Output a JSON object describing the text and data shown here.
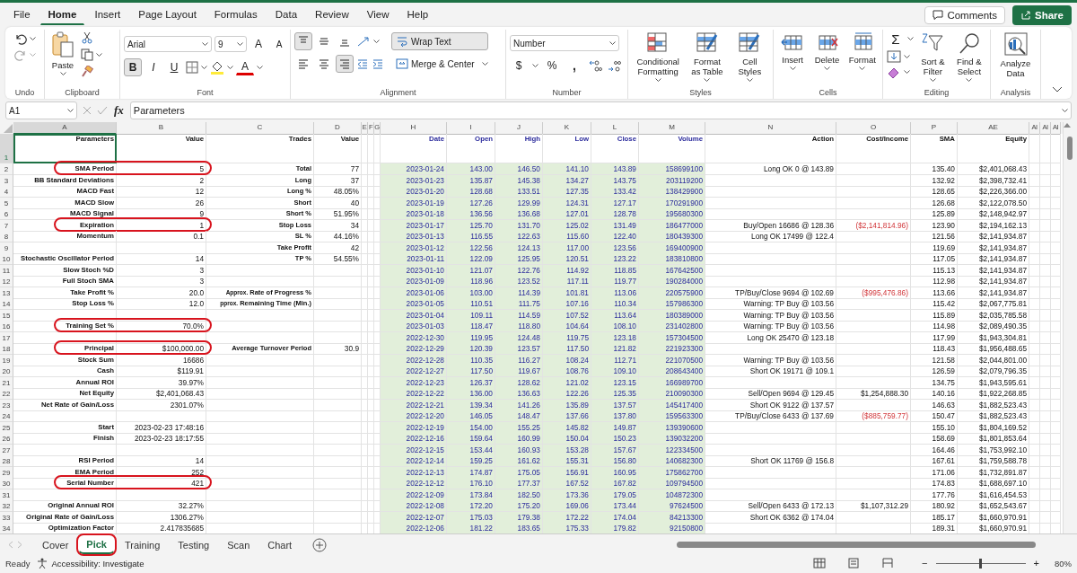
{
  "menu": {
    "tabs": [
      {
        "label": "File",
        "selected": false
      },
      {
        "label": "Home",
        "selected": true
      },
      {
        "label": "Insert",
        "selected": false
      },
      {
        "label": "Page Layout",
        "selected": false
      },
      {
        "label": "Formulas",
        "selected": false
      },
      {
        "label": "Data",
        "selected": false
      },
      {
        "label": "Review",
        "selected": false
      },
      {
        "label": "View",
        "selected": false
      },
      {
        "label": "Help",
        "selected": false
      }
    ],
    "comments": "Comments",
    "share": "Share"
  },
  "ribbon": {
    "undo": {
      "label": "Undo"
    },
    "clipboard": {
      "label": "Clipboard",
      "paste": "Paste"
    },
    "font": {
      "label": "Font",
      "name": "Arial",
      "size": "9",
      "grow": "A",
      "shrink": "A",
      "styles": [
        {
          "label": "B",
          "selected": true
        },
        {
          "label": "I",
          "selected": false
        },
        {
          "label": "U",
          "selected": false
        }
      ],
      "color_letter": "A"
    },
    "alignment": {
      "label": "Alignment",
      "vertical": [
        {
          "kind": "top",
          "selected": true
        },
        {
          "kind": "middle",
          "selected": false
        },
        {
          "kind": "bottom",
          "selected": false
        }
      ],
      "horizontal": [
        {
          "kind": "left",
          "selected": false
        },
        {
          "kind": "center",
          "selected": false
        },
        {
          "kind": "right",
          "selected": true
        }
      ],
      "wrap": {
        "label": "Wrap Text",
        "selected": true
      },
      "merge": "Merge & Center"
    },
    "number": {
      "label": "Number",
      "format": "Number",
      "currency": "$",
      "percent": "%",
      "comma": ","
    },
    "styles": {
      "label": "Styles",
      "buttons": [
        "Conditional Formatting",
        "Format as Table",
        "Cell Styles"
      ]
    },
    "cells": {
      "label": "Cells",
      "buttons": [
        "Insert",
        "Delete",
        "Format"
      ]
    },
    "editing": {
      "label": "Editing",
      "sum": "Σ",
      "sort": "Sort & Filter",
      "find": "Find & Select"
    },
    "analysis": {
      "label": "Analysis",
      "analyze": "Analyze Data"
    }
  },
  "formula_bar": {
    "name_box": "A1",
    "fx": "fx",
    "formula": "Parameters"
  },
  "grid": {
    "columns": [
      {
        "letter": "A",
        "heading": "Parameters",
        "selected": true
      },
      {
        "letter": "B",
        "heading": "Value",
        "selected": false
      },
      {
        "letter": "C",
        "heading": "Trades",
        "selected": false
      },
      {
        "letter": "D",
        "heading": "Value",
        "selected": false
      },
      {
        "letter": "E",
        "selected": false
      },
      {
        "letter": "F",
        "selected": false
      },
      {
        "letter": "G",
        "selected": false
      },
      {
        "letter": "H",
        "heading": "Date",
        "selected": false
      },
      {
        "letter": "I",
        "heading": "Open",
        "selected": false
      },
      {
        "letter": "J",
        "heading": "High",
        "selected": false
      },
      {
        "letter": "K",
        "heading": "Low",
        "selected": false
      },
      {
        "letter": "L",
        "heading": "Close",
        "selected": false
      },
      {
        "letter": "M",
        "heading": "Volume",
        "selected": false
      },
      {
        "letter": "N",
        "heading": "Action",
        "selected": false
      },
      {
        "letter": "O",
        "heading": "Cost/Income",
        "selected": false
      },
      {
        "letter": "P",
        "heading": "SMA",
        "selected": false
      },
      {
        "letter": "AE",
        "heading": "Equity",
        "selected": false
      },
      {
        "letter": "AI",
        "selected": false
      },
      {
        "letter": "AI",
        "selected": false
      },
      {
        "letter": "AI",
        "selected": false
      }
    ],
    "header_row": {
      "row": "1",
      "selected": true
    },
    "rows": [
      {
        "row": "2",
        "highlighted": true,
        "parameter": "SMA Period",
        "value": "5",
        "trade": "Total",
        "trade_value": "77",
        "date": "2023-01-24",
        "open": "143.00",
        "high": "146.50",
        "low": "141.10",
        "close": "143.89",
        "volume": "158699100",
        "action": "Long OK 0 @ 143.89",
        "sma": "135.40",
        "equity": "$2,401,068.43"
      },
      {
        "row": "3",
        "highlighted": false,
        "parameter": "BB Standard Deviations",
        "value": "2",
        "trade": "Long",
        "trade_value": "37",
        "date": "2023-01-23",
        "open": "135.87",
        "high": "145.38",
        "low": "134.27",
        "close": "143.75",
        "volume": "203119200",
        "sma": "132.92",
        "equity": "$2,398,732.41"
      },
      {
        "row": "4",
        "highlighted": false,
        "parameter": "MACD Fast",
        "value": "12",
        "trade": "Long %",
        "trade_value": "48.05%",
        "date": "2023-01-20",
        "open": "128.68",
        "high": "133.51",
        "low": "127.35",
        "close": "133.42",
        "volume": "138429900",
        "sma": "128.65",
        "equity": "$2,226,366.00"
      },
      {
        "row": "5",
        "highlighted": false,
        "parameter": "MACD Slow",
        "value": "26",
        "trade": "Short",
        "trade_value": "40",
        "date": "2023-01-19",
        "open": "127.26",
        "high": "129.99",
        "low": "124.31",
        "close": "127.17",
        "volume": "170291900",
        "sma": "126.68",
        "equity": "$2,122,078.50"
      },
      {
        "row": "6",
        "highlighted": false,
        "parameter": "MACD Signal",
        "value": "9",
        "trade": "Short %",
        "trade_value": "51.95%",
        "date": "2023-01-18",
        "open": "136.56",
        "high": "136.68",
        "low": "127.01",
        "close": "128.78",
        "volume": "195680300",
        "sma": "125.89",
        "equity": "$2,148,942.97"
      },
      {
        "row": "7",
        "highlighted": true,
        "parameter": "Expiration",
        "value": "1",
        "trade": "Stop Loss",
        "trade_value": "34",
        "date": "2023-01-17",
        "open": "125.70",
        "high": "131.70",
        "low": "125.02",
        "close": "131.49",
        "volume": "186477000",
        "action": "Buy/Open 16686 @ 128.36",
        "cost_income": "($2,141,814.96)",
        "cost_negative": true,
        "sma": "123.90",
        "equity": "$2,194,162.13"
      },
      {
        "row": "8",
        "highlighted": false,
        "parameter": "Momentum",
        "value": "0.1",
        "trade": "SL %",
        "trade_value": "44.16%",
        "date": "2023-01-13",
        "open": "116.55",
        "high": "122.63",
        "low": "115.60",
        "close": "122.40",
        "volume": "180439300",
        "action": "Long OK 17499 @ 122.4",
        "sma": "121.56",
        "equity": "$2,141,934.87"
      },
      {
        "row": "9",
        "highlighted": false,
        "trade": "Take Profit",
        "trade_value": "42",
        "date": "2023-01-12",
        "open": "122.56",
        "high": "124.13",
        "low": "117.00",
        "close": "123.56",
        "volume": "169400900",
        "sma": "119.69",
        "equity": "$2,141,934.87"
      },
      {
        "row": "10",
        "highlighted": false,
        "parameter": "Stochastic Oscillator Period",
        "value": "14",
        "trade": "TP %",
        "trade_value": "54.55%",
        "date": "2023-01-11",
        "open": "122.09",
        "high": "125.95",
        "low": "120.51",
        "close": "123.22",
        "volume": "183810800",
        "sma": "117.05",
        "equity": "$2,141,934.87"
      },
      {
        "row": "11",
        "highlighted": false,
        "parameter": "Slow Stoch %D",
        "value": "3",
        "date": "2023-01-10",
        "open": "121.07",
        "high": "122.76",
        "low": "114.92",
        "close": "118.85",
        "volume": "167642500",
        "sma": "115.13",
        "equity": "$2,141,934.87"
      },
      {
        "row": "12",
        "highlighted": false,
        "parameter": "Full Stoch SMA",
        "value": "3",
        "date": "2023-01-09",
        "open": "118.96",
        "high": "123.52",
        "low": "117.11",
        "close": "119.77",
        "volume": "190284000",
        "sma": "112.98",
        "equity": "$2,141,934.87"
      },
      {
        "row": "13",
        "highlighted": false,
        "parameter": "Take Profit %",
        "value": "20.0",
        "trade_note": "Approx.",
        "trade": "Rate of Progress %",
        "date": "2023-01-06",
        "open": "103.00",
        "high": "114.39",
        "low": "101.81",
        "close": "113.06",
        "volume": "220575900",
        "action": "TP/Buy/Close 9694 @ 102.69",
        "cost_income": "($995,476.86)",
        "cost_negative": true,
        "sma": "113.66",
        "equity": "$2,141,934.87"
      },
      {
        "row": "14",
        "highlighted": false,
        "parameter": "Stop Loss %",
        "value": "12.0",
        "trade_note": "pprox.",
        "trade": "Remaining Time (Min.)",
        "date": "2023-01-05",
        "open": "110.51",
        "high": "111.75",
        "low": "107.16",
        "close": "110.34",
        "volume": "157986300",
        "action": "Warning: TP Buy @ 103.56",
        "sma": "115.42",
        "equity": "$2,067,775.81"
      },
      {
        "row": "15",
        "highlighted": false,
        "date": "2023-01-04",
        "open": "109.11",
        "high": "114.59",
        "low": "107.52",
        "close": "113.64",
        "volume": "180389000",
        "action": "Warning: TP Buy @ 103.56",
        "sma": "115.89",
        "equity": "$2,035,785.58"
      },
      {
        "row": "16",
        "highlighted": true,
        "parameter": "Training Set %",
        "value": "70.0%",
        "date": "2023-01-03",
        "open": "118.47",
        "high": "118.80",
        "low": "104.64",
        "close": "108.10",
        "volume": "231402800",
        "action": "Warning: TP Buy @ 103.56",
        "sma": "114.98",
        "equity": "$2,089,490.35"
      },
      {
        "row": "17",
        "highlighted": false,
        "date": "2022-12-30",
        "open": "119.95",
        "high": "124.48",
        "low": "119.75",
        "close": "123.18",
        "volume": "157304500",
        "action": "Long OK 25470 @ 123.18",
        "sma": "117.99",
        "equity": "$1,943,304.81"
      },
      {
        "row": "18",
        "highlighted": true,
        "parameter": "Principal",
        "value": "$100,000.00",
        "trade": "Average Turnover Period",
        "trade_value": "30.9",
        "date": "2022-12-29",
        "open": "120.39",
        "high": "123.57",
        "low": "117.50",
        "close": "121.82",
        "volume": "221923300",
        "sma": "118.43",
        "equity": "$1,956,488.65"
      },
      {
        "row": "19",
        "highlighted": false,
        "parameter": "Stock Sum",
        "value": "16686",
        "date": "2022-12-28",
        "open": "110.35",
        "high": "116.27",
        "low": "108.24",
        "close": "112.71",
        "volume": "221070500",
        "action": "Warning: TP Buy @ 103.56",
        "sma": "121.58",
        "equity": "$2,044,801.00"
      },
      {
        "row": "20",
        "highlighted": false,
        "parameter": "Cash",
        "value": "$119.91",
        "date": "2022-12-27",
        "open": "117.50",
        "high": "119.67",
        "low": "108.76",
        "close": "109.10",
        "volume": "208643400",
        "action": "Short OK 19171 @ 109.1",
        "sma": "126.59",
        "equity": "$2,079,796.35"
      },
      {
        "row": "21",
        "highlighted": false,
        "parameter": "Annual ROI",
        "value": "39.97%",
        "date": "2022-12-23",
        "open": "126.37",
        "high": "128.62",
        "low": "121.02",
        "close": "123.15",
        "volume": "166989700",
        "sma": "134.75",
        "equity": "$1,943,595.61"
      },
      {
        "row": "22",
        "highlighted": false,
        "parameter": "Net Equity",
        "value": "$2,401,068.43",
        "date": "2022-12-22",
        "open": "136.00",
        "high": "136.63",
        "low": "122.26",
        "close": "125.35",
        "volume": "210090300",
        "action": "Sell/Open 9694 @ 129.45",
        "cost_income": "$1,254,888.30",
        "cost_negative": false,
        "sma": "140.16",
        "equity": "$1,922,268.85"
      },
      {
        "row": "23",
        "highlighted": false,
        "parameter": "Net Rate of Gain/Loss",
        "value": "2301.07%",
        "date": "2022-12-21",
        "open": "139.34",
        "high": "141.26",
        "low": "135.89",
        "close": "137.57",
        "volume": "145417400",
        "action": "Short OK 9122 @ 137.57",
        "sma": "146.63",
        "equity": "$1,882,523.43"
      },
      {
        "row": "24",
        "highlighted": false,
        "date": "2022-12-20",
        "open": "146.05",
        "high": "148.47",
        "low": "137.66",
        "close": "137.80",
        "volume": "159563300",
        "action": "TP/Buy/Close 6433 @ 137.69",
        "cost_income": "($885,759.77)",
        "cost_negative": true,
        "sma": "150.47",
        "equity": "$1,882,523.43"
      },
      {
        "row": "25",
        "highlighted": false,
        "parameter": "Start",
        "value": "2023-02-23 17:48:16",
        "date": "2022-12-19",
        "open": "154.00",
        "high": "155.25",
        "low": "145.82",
        "close": "149.87",
        "volume": "139390600",
        "sma": "155.10",
        "equity": "$1,804,169.52"
      },
      {
        "row": "26",
        "highlighted": false,
        "parameter": "Finish",
        "value": "2023-02-23 18:17:55",
        "date": "2022-12-16",
        "open": "159.64",
        "high": "160.99",
        "low": "150.04",
        "close": "150.23",
        "volume": "139032200",
        "sma": "158.69",
        "equity": "$1,801,853.64"
      },
      {
        "row": "27",
        "highlighted": false,
        "date": "2022-12-15",
        "open": "153.44",
        "high": "160.93",
        "low": "153.28",
        "close": "157.67",
        "volume": "122334500",
        "sma": "164.46",
        "equity": "$1,753,992.10"
      },
      {
        "row": "28",
        "highlighted": false,
        "parameter": "RSI Period",
        "value": "14",
        "date": "2022-12-14",
        "open": "159.25",
        "high": "161.62",
        "low": "155.31",
        "close": "156.80",
        "volume": "140682300",
        "action": "Short OK 11769 @ 156.8",
        "sma": "167.61",
        "equity": "$1,759,588.78"
      },
      {
        "row": "29",
        "highlighted": false,
        "parameter": "EMA Period",
        "value": "252",
        "date": "2022-12-13",
        "open": "174.87",
        "high": "175.05",
        "low": "156.91",
        "close": "160.95",
        "volume": "175862700",
        "sma": "171.06",
        "equity": "$1,732,891.87"
      },
      {
        "row": "30",
        "highlighted": true,
        "parameter": "Serial Number",
        "value": "421",
        "date": "2022-12-12",
        "open": "176.10",
        "high": "177.37",
        "low": "167.52",
        "close": "167.82",
        "volume": "109794500",
        "sma": "174.83",
        "equity": "$1,688,697.10"
      },
      {
        "row": "31",
        "highlighted": false,
        "date": "2022-12-09",
        "open": "173.84",
        "high": "182.50",
        "low": "173.36",
        "close": "179.05",
        "volume": "104872300",
        "sma": "177.76",
        "equity": "$1,616,454.53"
      },
      {
        "row": "32",
        "highlighted": false,
        "parameter": "Original Annual ROI",
        "value": "32.27%",
        "date": "2022-12-08",
        "open": "172.20",
        "high": "175.20",
        "low": "169.06",
        "close": "173.44",
        "volume": "97624500",
        "action": "Sell/Open 6433 @ 172.13",
        "cost_income": "$1,107,312.29",
        "cost_negative": false,
        "sma": "180.92",
        "equity": "$1,652,543.67"
      },
      {
        "row": "33",
        "highlighted": false,
        "parameter": "Original Rate of Gain/Loss",
        "value": "1306.27%",
        "date": "2022-12-07",
        "open": "175.03",
        "high": "179.38",
        "low": "172.22",
        "close": "174.04",
        "volume": "84213300",
        "action": "Short OK 6362 @ 174.04",
        "sma": "185.17",
        "equity": "$1,660,970.91"
      },
      {
        "row": "34",
        "highlighted": false,
        "parameter": "Optimization Factor",
        "value": "2.417835685",
        "date": "2022-12-06",
        "open": "181.22",
        "high": "183.65",
        "low": "175.33",
        "close": "179.82",
        "volume": "92150800",
        "sma": "189.31",
        "equity": "$1,660,970.91"
      }
    ]
  },
  "sheet_tabs": [
    {
      "label": "Cover",
      "selected": false,
      "highlighted": false
    },
    {
      "label": "Pick",
      "selected": true,
      "highlighted": true
    },
    {
      "label": "Training",
      "selected": false,
      "highlighted": false
    },
    {
      "label": "Testing",
      "selected": false,
      "highlighted": false
    },
    {
      "label": "Scan",
      "selected": false,
      "highlighted": false
    },
    {
      "label": "Chart",
      "selected": false,
      "highlighted": false
    }
  ],
  "status_bar": {
    "mode": "Ready",
    "accessibility": "Accessibility: Investigate",
    "zoom_out": "−",
    "zoom_in": "+",
    "zoom": "80%",
    "zoom_level": {
      "level": 0.5
    }
  }
}
